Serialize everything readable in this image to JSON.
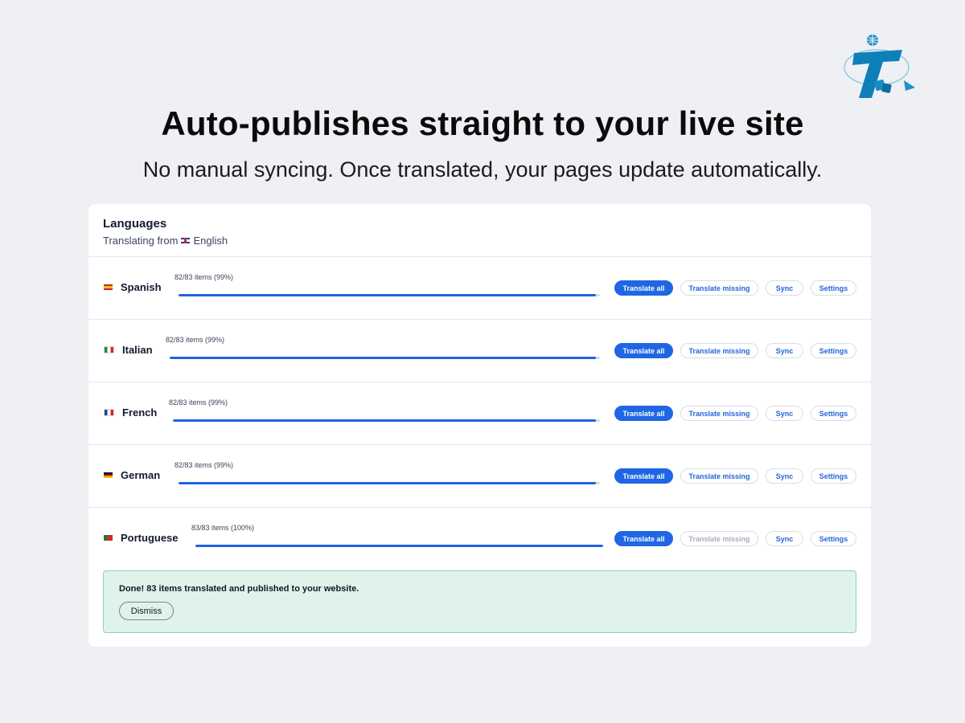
{
  "hero": {
    "title": "Auto-publishes straight to your live site",
    "subtitle": "No manual syncing. Once translated, your pages update automatically."
  },
  "card": {
    "title": "Languages",
    "translating_from_prefix": "Translating from",
    "source_language": "English",
    "source_flag": "flag-uk-icon"
  },
  "buttons": {
    "translate_all": "Translate all",
    "translate_missing": "Translate missing",
    "sync": "Sync",
    "settings": "Settings"
  },
  "languages": [
    {
      "name": "Spanish",
      "flag": "flag-spain-icon",
      "count_text": "82/83 items (99%)",
      "progress": 0.99,
      "translate_missing_enabled": true
    },
    {
      "name": "Italian",
      "flag": "flag-italy-icon",
      "count_text": "82/83 items (99%)",
      "progress": 0.99,
      "translate_missing_enabled": true
    },
    {
      "name": "French",
      "flag": "flag-france-icon",
      "count_text": "82/83 items (99%)",
      "progress": 0.99,
      "translate_missing_enabled": true
    },
    {
      "name": "German",
      "flag": "flag-germany-icon",
      "count_text": "82/83 items (99%)",
      "progress": 0.99,
      "translate_missing_enabled": true
    },
    {
      "name": "Portuguese",
      "flag": "flag-portugal-icon",
      "count_text": "83/83 items (100%)",
      "progress": 1.0,
      "translate_missing_enabled": false
    }
  ],
  "notice": {
    "message": "Done! 83 items translated and published to your website.",
    "dismiss_label": "Dismiss"
  },
  "colors": {
    "primary": "#1f66e5",
    "progress": "#1f63e0",
    "success_bg": "#e0f3ea",
    "success_border": "#8fd2ac",
    "page_bg": "#eef0f4"
  }
}
